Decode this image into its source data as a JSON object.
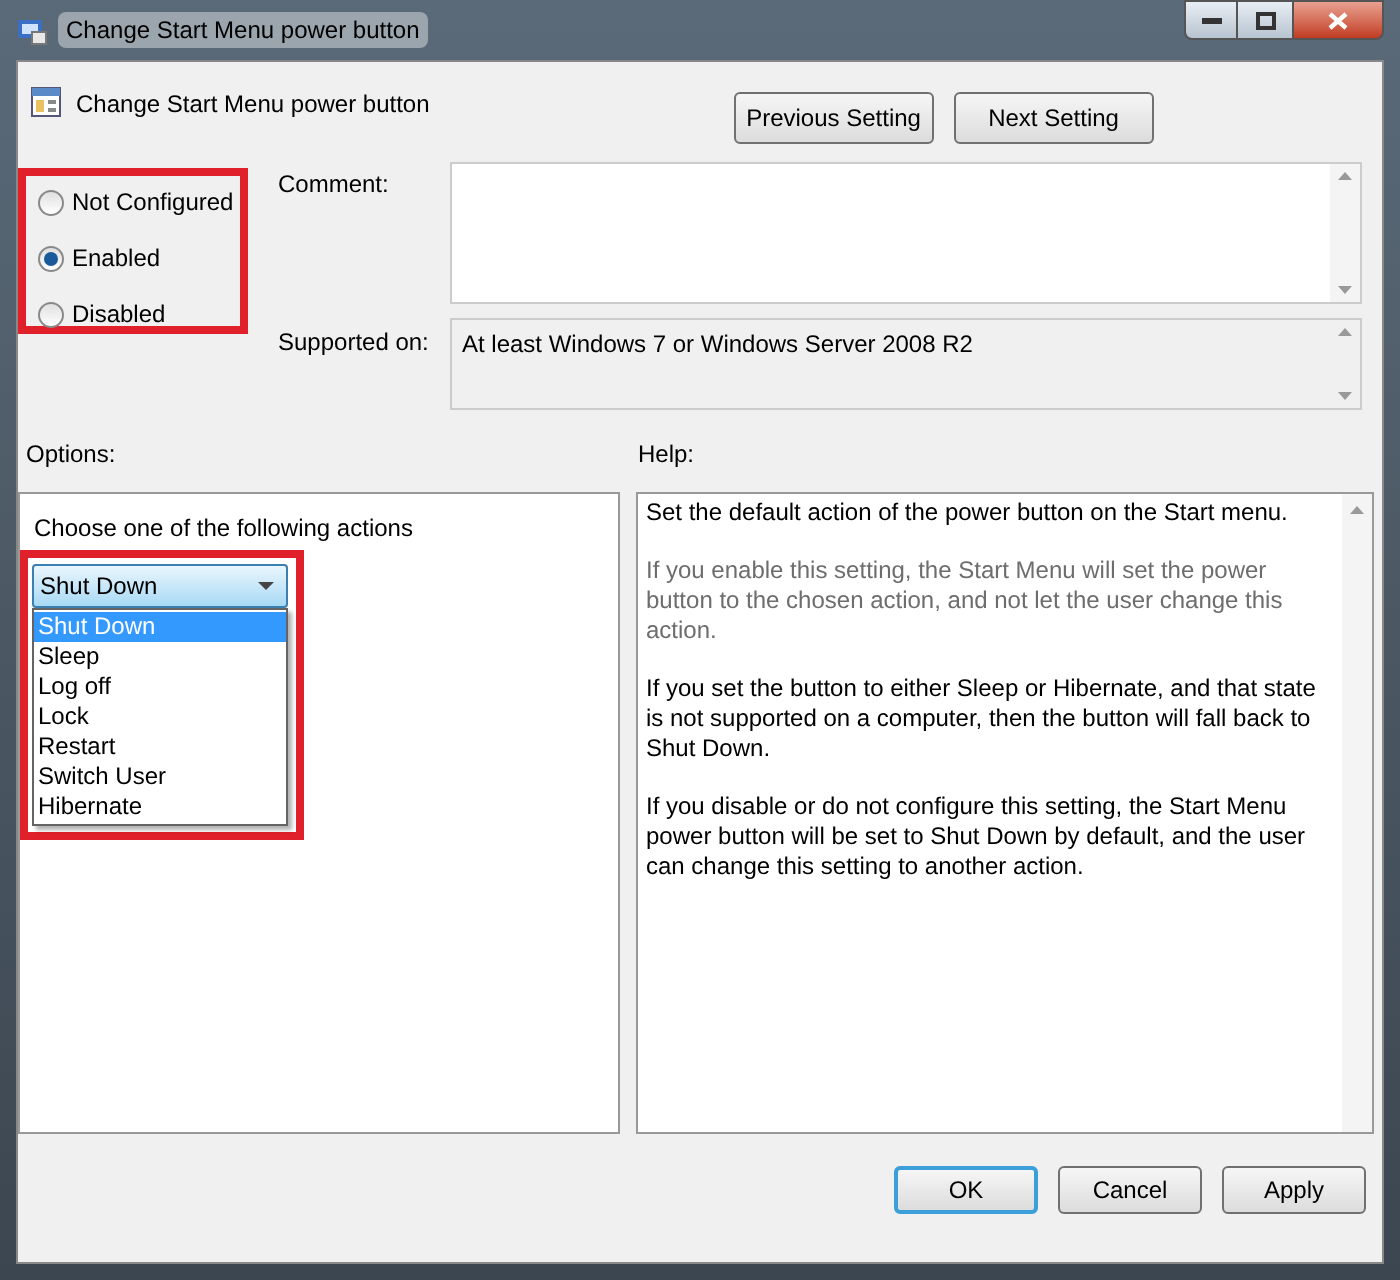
{
  "window": {
    "title": "Change Start Menu power button"
  },
  "header": {
    "title": "Change Start Menu power button",
    "buttons": [
      "Previous Setting",
      "Next Setting"
    ]
  },
  "state": {
    "highlighted": true,
    "options": [
      {
        "label": "Not Configured",
        "selected": false
      },
      {
        "label": "Enabled",
        "selected": true
      },
      {
        "label": "Disabled",
        "selected": false
      }
    ]
  },
  "comment": {
    "label": "Comment:"
  },
  "supported_on": {
    "label": "Supported on:",
    "value": "At least Windows 7 or Windows Server 2008 R2"
  },
  "options": {
    "label": "Options:",
    "prompt": "Choose one of the following actions",
    "dropdown": {
      "highlighted": true,
      "value": "Shut Down",
      "expanded": true,
      "items": [
        {
          "label": "Shut Down",
          "selected": true
        },
        {
          "label": "Sleep",
          "selected": false
        },
        {
          "label": "Log off",
          "selected": false
        },
        {
          "label": "Lock",
          "selected": false
        },
        {
          "label": "Restart",
          "selected": false
        },
        {
          "label": "Switch User",
          "selected": false
        },
        {
          "label": "Hibernate",
          "selected": false
        }
      ]
    }
  },
  "help": {
    "label": "Help:",
    "paragraphs": [
      {
        "text": "Set the default action of the power button on the Start menu.",
        "dimmed": false
      },
      {
        "text": "If you enable this setting, the Start Menu will set the power button to the chosen action, and not let the user change this action.",
        "dimmed": true
      },
      {
        "text": "If you set the button to either Sleep or Hibernate, and that state is not supported on a computer, then the button will fall back to Shut Down.",
        "dimmed": false
      },
      {
        "text": "If you disable or do not configure this setting, the Start Menu power button will be set to Shut Down by default, and the user can change this setting to another action.",
        "dimmed": false
      }
    ]
  },
  "buttons": [
    {
      "label": "OK",
      "default": true
    },
    {
      "label": "Cancel",
      "default": false
    },
    {
      "label": "Apply",
      "default": false
    }
  ]
}
